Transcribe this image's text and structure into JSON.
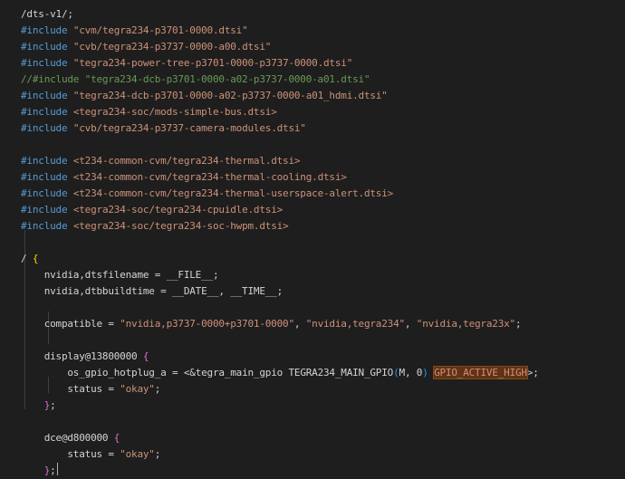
{
  "editor": {
    "theme": {
      "background": "#1e1e1e",
      "keyword": "#569cd6",
      "string": "#ce9178",
      "comment": "#6a9955",
      "text": "#d4d4d4",
      "bracket_gold": "#ffd700",
      "bracket_purple": "#da70d6",
      "bracket_blue": "#179fff",
      "highlight_bg": "#613214"
    },
    "lines": [
      [
        {
          "t": "/dts-v1/;",
          "c": "plain"
        }
      ],
      [
        {
          "t": "#include",
          "c": "kw"
        },
        {
          "t": " ",
          "c": "plain"
        },
        {
          "t": "\"cvm/tegra234-p3701-0000.dtsi\"",
          "c": "str"
        }
      ],
      [
        {
          "t": "#include",
          "c": "kw"
        },
        {
          "t": " ",
          "c": "plain"
        },
        {
          "t": "\"cvb/tegra234-p3737-0000-a00.dtsi\"",
          "c": "str"
        }
      ],
      [
        {
          "t": "#include",
          "c": "kw"
        },
        {
          "t": " ",
          "c": "plain"
        },
        {
          "t": "\"tegra234-power-tree-p3701-0000-p3737-0000.dtsi\"",
          "c": "str"
        }
      ],
      [
        {
          "t": "//#include \"tegra234-dcb-p3701-0000-a02-p3737-0000-a01.dtsi\"",
          "c": "comment"
        }
      ],
      [
        {
          "t": "#include",
          "c": "kw"
        },
        {
          "t": " ",
          "c": "plain"
        },
        {
          "t": "\"tegra234-dcb-p3701-0000-a02-p3737-0000-a01_hdmi.dtsi\"",
          "c": "str"
        }
      ],
      [
        {
          "t": "#include",
          "c": "kw"
        },
        {
          "t": " ",
          "c": "plain"
        },
        {
          "t": "<tegra234-soc/mods-simple-bus.dtsi>",
          "c": "str"
        }
      ],
      [
        {
          "t": "#include",
          "c": "kw"
        },
        {
          "t": " ",
          "c": "plain"
        },
        {
          "t": "\"cvb/tegra234-p3737-camera-modules.dtsi\"",
          "c": "str"
        }
      ],
      [],
      [
        {
          "t": "#include",
          "c": "kw"
        },
        {
          "t": " ",
          "c": "plain"
        },
        {
          "t": "<t234-common-cvm/tegra234-thermal.dtsi>",
          "c": "str"
        }
      ],
      [
        {
          "t": "#include",
          "c": "kw"
        },
        {
          "t": " ",
          "c": "plain"
        },
        {
          "t": "<t234-common-cvm/tegra234-thermal-cooling.dtsi>",
          "c": "str"
        }
      ],
      [
        {
          "t": "#include",
          "c": "kw"
        },
        {
          "t": " ",
          "c": "plain"
        },
        {
          "t": "<t234-common-cvm/tegra234-thermal-userspace-alert.dtsi>",
          "c": "str"
        }
      ],
      [
        {
          "t": "#include",
          "c": "kw"
        },
        {
          "t": " ",
          "c": "plain"
        },
        {
          "t": "<tegra234-soc/tegra234-cpuidle.dtsi>",
          "c": "str"
        }
      ],
      [
        {
          "t": "#include",
          "c": "kw"
        },
        {
          "t": " ",
          "c": "plain"
        },
        {
          "t": "<tegra234-soc/tegra234-soc-hwpm.dtsi>",
          "c": "str"
        }
      ],
      [],
      [
        {
          "t": "/ ",
          "c": "plain"
        },
        {
          "t": "{",
          "c": "bracket-gold"
        }
      ],
      [
        {
          "t": "    nvidia,dtsfilename = __FILE__;",
          "c": "plain"
        }
      ],
      [
        {
          "t": "    nvidia,dtbbuildtime = __DATE__, __TIME__;",
          "c": "plain"
        }
      ],
      [],
      [
        {
          "t": "    compatible = ",
          "c": "plain"
        },
        {
          "t": "\"nvidia,p3737-0000+p3701-0000\"",
          "c": "str"
        },
        {
          "t": ", ",
          "c": "plain"
        },
        {
          "t": "\"nvidia,tegra234\"",
          "c": "str"
        },
        {
          "t": ", ",
          "c": "plain"
        },
        {
          "t": "\"nvidia,tegra23x\"",
          "c": "str"
        },
        {
          "t": ";",
          "c": "plain"
        }
      ],
      [],
      [
        {
          "t": "    display@13800000 ",
          "c": "plain"
        },
        {
          "t": "{",
          "c": "bracket-purple"
        }
      ],
      [
        {
          "t": "        os_gpio_hotplug_a = ",
          "c": "plain"
        },
        {
          "t": "<",
          "c": "plain"
        },
        {
          "t": "&tegra_main_gpio",
          "c": "plain"
        },
        {
          "t": " TEGRA234_MAIN_GPIO",
          "c": "plain"
        },
        {
          "t": "(",
          "c": "bracket-blue"
        },
        {
          "t": "M, 0",
          "c": "plain"
        },
        {
          "t": ")",
          "c": "bracket-blue"
        },
        {
          "t": " ",
          "c": "plain"
        },
        {
          "t": "GPIO_ACTIVE_HIGH",
          "c": "hl"
        },
        {
          "t": ">;",
          "c": "plain"
        }
      ],
      [
        {
          "t": "        status = ",
          "c": "plain"
        },
        {
          "t": "\"okay\"",
          "c": "str"
        },
        {
          "t": ";",
          "c": "plain"
        }
      ],
      [
        {
          "t": "    ",
          "c": "plain"
        },
        {
          "t": "}",
          "c": "bracket-purple"
        },
        {
          "t": ";",
          "c": "plain"
        }
      ],
      [],
      [
        {
          "t": "    dce@d800000 ",
          "c": "plain"
        },
        {
          "t": "{",
          "c": "bracket-purple"
        }
      ],
      [
        {
          "t": "        status = ",
          "c": "plain"
        },
        {
          "t": "\"okay\"",
          "c": "str"
        },
        {
          "t": ";",
          "c": "plain"
        }
      ],
      [
        {
          "t": "    ",
          "c": "plain"
        },
        {
          "t": "}",
          "c": "bracket-purple"
        },
        {
          "t": ";",
          "c": "plain"
        },
        {
          "t": "",
          "c": "cursor"
        }
      ]
    ]
  }
}
